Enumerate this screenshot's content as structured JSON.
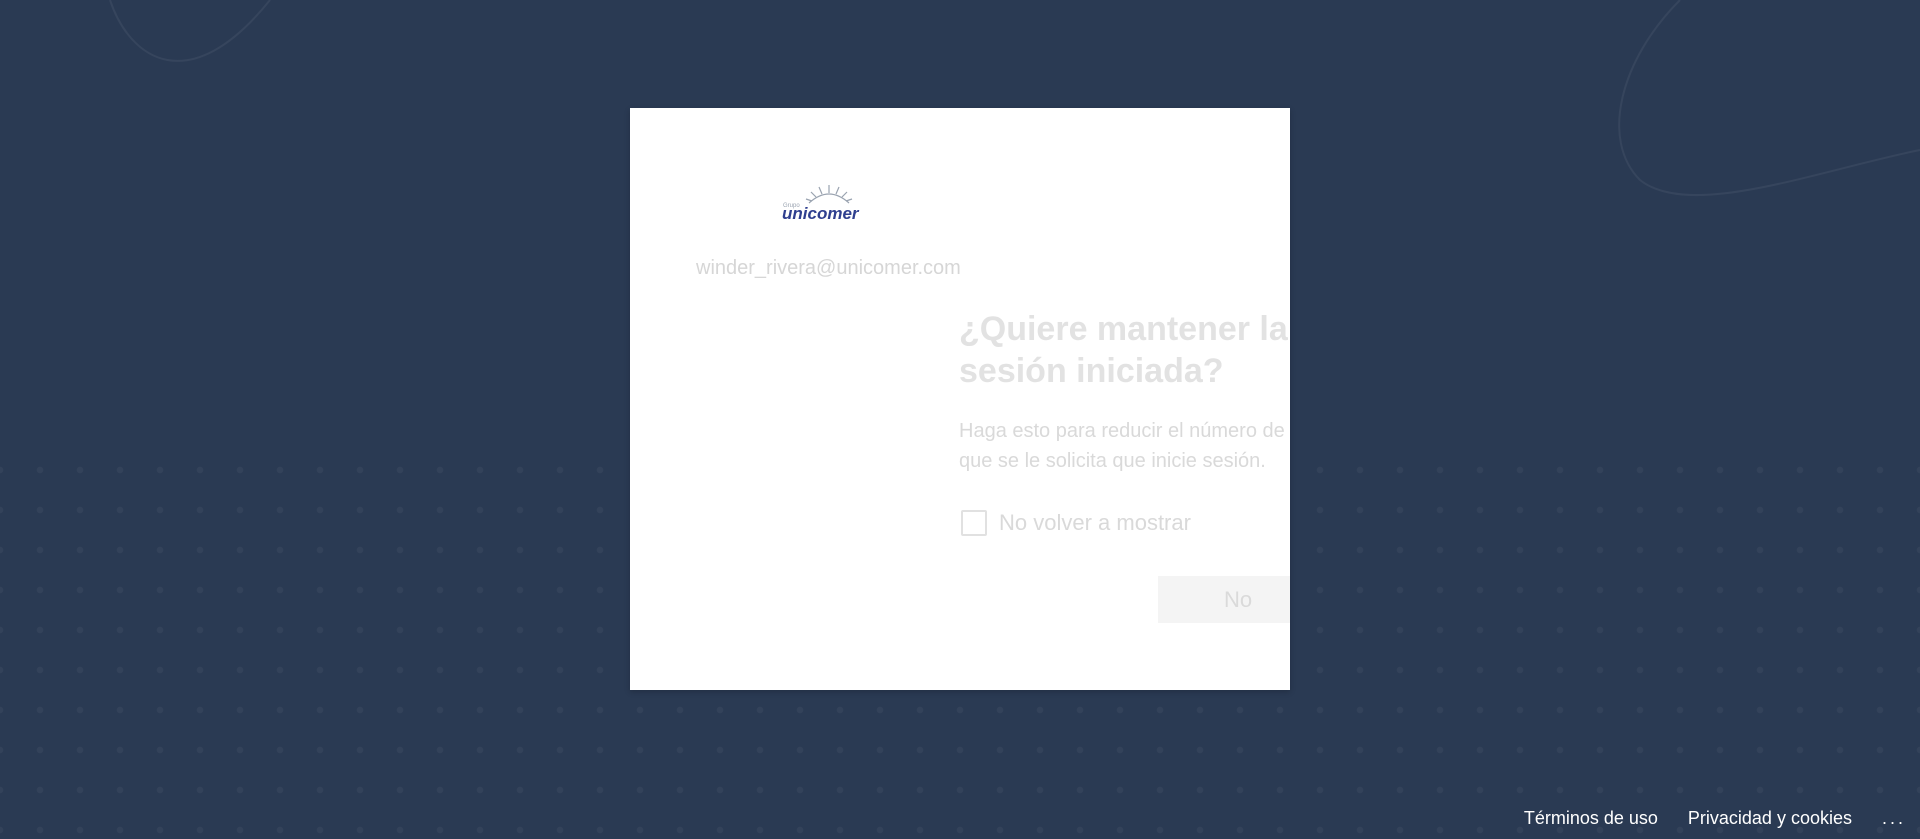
{
  "signin": {
    "logo_text": "unicomer",
    "identity": "winder_rivera@unicomer.com",
    "title": "¿Quiere mantener la sesión iniciada?",
    "description": "Haga esto para reducir el número de veces que se le solicita que inicie sesión.",
    "dont_show_again_label": "No volver a mostrar",
    "dont_show_again_checked": false,
    "no_button_label": "No"
  },
  "footer": {
    "terms_label": "Términos de uso",
    "privacy_label": "Privacidad y cookies",
    "more_label": "..."
  },
  "colors": {
    "background": "#2a3a53",
    "card": "#ffffff",
    "brand_blue": "#2f3f8f"
  }
}
